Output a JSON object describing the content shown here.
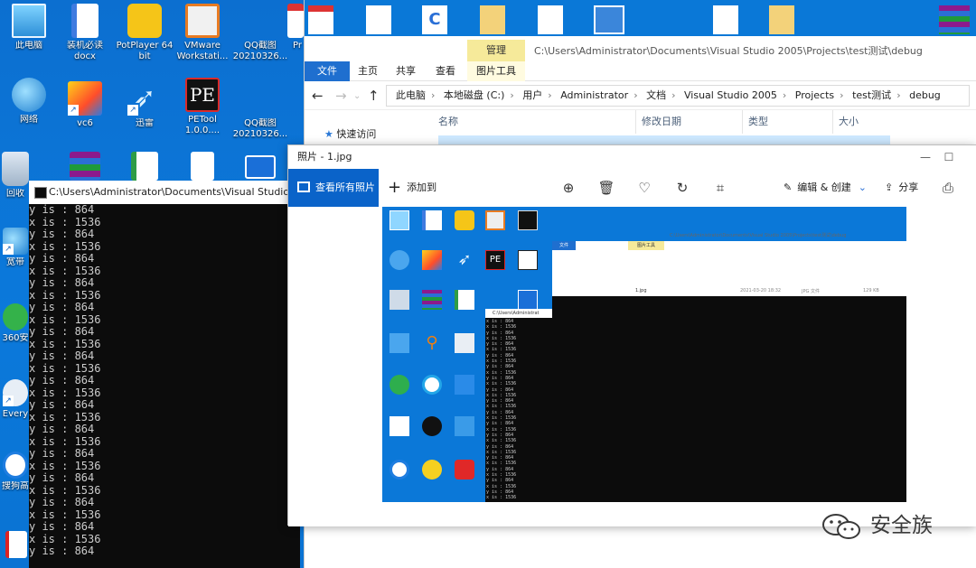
{
  "desktop": {
    "icons_col1": [
      {
        "label": "此电脑",
        "icon": "computer-icon"
      },
      {
        "label": "网络",
        "icon": "network-icon"
      },
      {
        "label": "回收",
        "icon": "recycle-bin-icon"
      },
      {
        "label": "宽带",
        "icon": "broadband-icon"
      },
      {
        "label": "360安",
        "icon": "360-icon"
      },
      {
        "label": "Every",
        "icon": "everything-icon"
      },
      {
        "label": "搜狗高",
        "icon": "sogou-icon"
      }
    ],
    "icons_row1": [
      {
        "label": "装机必读",
        "label2": "docx",
        "icon": "word-doc-icon"
      },
      {
        "label": "PotPlayer 64",
        "label2": "bit",
        "icon": "potplayer-icon"
      },
      {
        "label": "VMware",
        "label2": "Workstati...",
        "icon": "vmware-icon"
      },
      {
        "label": "QQ截图",
        "label2": "20210326...",
        "icon": "screenshot-icon"
      },
      {
        "label": "Pr",
        "label2": "",
        "icon": "pdf-icon"
      }
    ],
    "icons_row2": [
      {
        "label": "vc6",
        "label2": "",
        "icon": "vc6-icon"
      },
      {
        "label": "迅雷",
        "label2": "",
        "icon": "thunder-icon"
      },
      {
        "label": "PETool",
        "label2": "1.0.0....",
        "icon": "petool-icon"
      },
      {
        "label": "QQ截图",
        "label2": "20210326...",
        "icon": "screenshot-icon"
      }
    ]
  },
  "explorer": {
    "manage_tab": "管理",
    "title_path": "C:\\Users\\Administrator\\Documents\\Visual Studio 2005\\Projects\\test测试\\debug",
    "tabs": [
      "文件",
      "主页",
      "共享",
      "查看",
      "图片工具"
    ],
    "breadcrumb": [
      "此电脑",
      "本地磁盘 (C:)",
      "用户",
      "Administrator",
      "文档",
      "Visual Studio 2005",
      "Projects",
      "test测试",
      "debug"
    ],
    "columns": [
      "名称",
      "修改日期",
      "类型",
      "大小"
    ],
    "nav_item": "快速访问"
  },
  "console": {
    "title": "C:\\Users\\Administrator\\Documents\\Visual Studio 2005",
    "lines": [
      "y is : 864",
      "x is : 1536",
      "y is : 864",
      "x is : 1536",
      "y is : 864",
      "x is : 1536",
      "y is : 864",
      "x is : 1536",
      "y is : 864",
      "x is : 1536",
      "y is : 864",
      "x is : 1536",
      "y is : 864",
      "x is : 1536",
      "y is : 864",
      "x is : 1536",
      "y is : 864",
      "x is : 1536",
      "y is : 864",
      "x is : 1536",
      "y is : 864",
      "x is : 1536",
      "y is : 864",
      "x is : 1536",
      "y is : 864",
      "x is : 1536",
      "y is : 864",
      "x is : 1536",
      "y is : 864"
    ]
  },
  "photos": {
    "title": "照片 - 1.jpg",
    "view_all": "查看所有照片",
    "add_to": "添加到",
    "edit_create": "编辑 & 创建",
    "share": "分享"
  },
  "inner_shot": {
    "console_title": "C:\\Users\\Administrat",
    "console_lines": [
      "x is : 864",
      "x is : 1536",
      "y is : 864",
      "x is : 1536",
      "y is : 864",
      "x is : 1536",
      "y is : 864",
      "x is : 1536",
      "y is : 864",
      "x is : 1536",
      "y is : 864",
      "x is : 1536",
      "y is : 864",
      "x is : 1536",
      "y is : 864",
      "x is : 1536",
      "y is : 864",
      "x is : 1536",
      "y is : 864",
      "x is : 1536",
      "y is : 864",
      "x is : 1536",
      "y is : 864",
      "x is : 1536",
      "y is : 864",
      "x is : 1536",
      "y is : 864",
      "x is : 1536",
      "y is : 864",
      "x is : 1536",
      "y is : 864",
      "x is : 1536"
    ],
    "file_row": "1.jpg",
    "file_date": "2021-03-20 18:32",
    "file_type": "JPG 文件",
    "file_size": "129 KB"
  },
  "watermark": {
    "text": "安全族"
  },
  "colors": {
    "desktop_blue": "#0a78d7",
    "accent": "#0a63c9",
    "console_bg": "#0c0c0c",
    "console_text": "#cccccc"
  }
}
